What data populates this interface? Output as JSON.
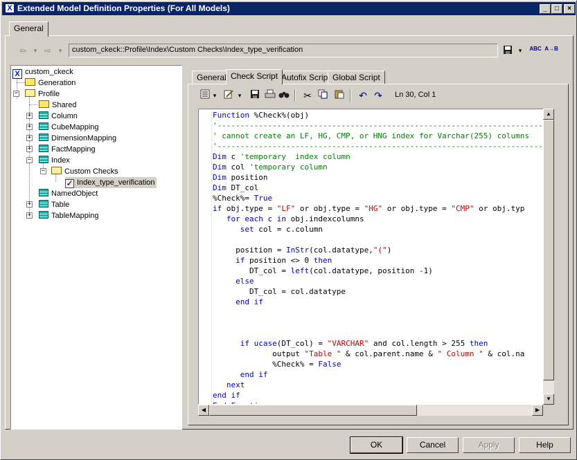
{
  "window": {
    "title": "Extended Model Definition Properties (For All Models)",
    "app_icon": "X",
    "minimize_glyph": "_",
    "maximize_glyph": "□",
    "close_glyph": "×"
  },
  "top_tabs": [
    {
      "label": "General",
      "active": true
    }
  ],
  "nav": {
    "back_icon": "⇦",
    "forward_icon": "⇨",
    "dropdown_icon": "▾",
    "path": "custom_ckeck::Profile\\Index\\Custom Checks\\Index_type_verification",
    "save_icon": "save-icon",
    "spell_icon": "ABC",
    "replace_icon": "A→B"
  },
  "tree": [
    {
      "label": "custom_ckeck",
      "icon": "model-icon"
    },
    {
      "label": "Generation",
      "icon": "folder-icon"
    },
    {
      "label": "Profile",
      "icon": "folder-open-icon"
    },
    {
      "label": "Shared",
      "icon": "folder-icon"
    },
    {
      "label": "Column",
      "icon": "table-icon"
    },
    {
      "label": "CubeMapping",
      "icon": "table-icon"
    },
    {
      "label": "DimensionMapping",
      "icon": "table-icon"
    },
    {
      "label": "FactMapping",
      "icon": "table-icon"
    },
    {
      "label": "Index",
      "icon": "table-icon"
    },
    {
      "label": "Custom Checks",
      "icon": "folder-open-icon"
    },
    {
      "label": "Index_type_verification",
      "icon": "check-icon",
      "selected": true
    },
    {
      "label": "NamedObject",
      "icon": "table-icon"
    },
    {
      "label": "Table",
      "icon": "table-icon"
    },
    {
      "label": "TableMapping",
      "icon": "table-icon"
    }
  ],
  "tabs": [
    {
      "label": "General"
    },
    {
      "label": "Check Script",
      "active": true
    },
    {
      "label": "Autofix Script"
    },
    {
      "label": "Global Script"
    }
  ],
  "editor_toolbar": {
    "cursor_position": "Ln 30, Col 1"
  },
  "code": [
    "Function %Check%(obj)",
    "'-------------------------------------------------------------------------",
    "' cannot create an LF, HG, CMP, or HNG index for Varchar(255) columns",
    "'-------------------------------------------------------------------------",
    "Dim c 'temporary  index column",
    "Dim col 'temporary column",
    "Dim position",
    "Dim DT_col",
    "%Check%= True",
    "if obj.type = \"LF\" or obj.type = \"HG\" or obj.type = \"CMP\" or obj.typ",
    "   for each c in obj.indexcolumns",
    "      set col = c.column",
    "",
    "     position = InStr(col.datatype,\"(\")",
    "     if position <> 0 then",
    "        DT_col = left(col.datatype, position -1)",
    "     else",
    "        DT_col = col.datatype",
    "     end if",
    "",
    "",
    "",
    "      if ucase(DT_col) = \"VARCHAR\" and col.length > 255 then",
    "             output \"Table \" & col.parent.name & \" Column \" & col.na",
    "             %Check% = False",
    "      end if",
    "   next",
    "end if",
    "End Function"
  ],
  "buttons": {
    "ok": "OK",
    "cancel": "Cancel",
    "apply": "Apply",
    "help": "Help"
  }
}
